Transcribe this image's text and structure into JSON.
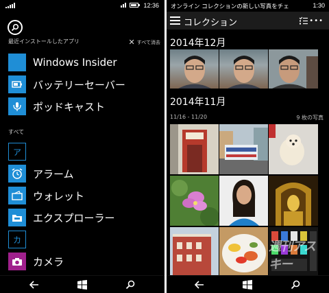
{
  "left_phone": {
    "status_time": "12:36",
    "recent_header": "最近インストールしたアプリ",
    "clear_label": "すべて消去",
    "recent_apps": [
      {
        "label": "Windows Insider",
        "icon": "windows-insider-icon"
      },
      {
        "label": "バッテリーセーバー",
        "icon": "battery-saver-icon"
      },
      {
        "label": "ポッドキャスト",
        "icon": "podcast-icon"
      }
    ],
    "all_header": "すべて",
    "letter_a": "ア",
    "apps_a": [
      {
        "label": "アラーム",
        "icon": "alarm-icon"
      },
      {
        "label": "ウォレット",
        "icon": "wallet-icon"
      },
      {
        "label": "エクスプローラー",
        "icon": "explorer-icon"
      }
    ],
    "letter_ka": "カ",
    "apps_ka": [
      {
        "label": "カメラ",
        "icon": "camera-icon"
      }
    ],
    "colors": {
      "accent": "#1f8ed6",
      "camera": "#a0208c",
      "background": "#000000"
    }
  },
  "right_phone": {
    "status_text": "オンライン コレクションの新しい写真をチェ",
    "status_time": "1:30",
    "header_title": "コレクション",
    "section_dec": "2014年12月",
    "section_nov": "2014年11月",
    "date_range": "11/16 - 11/20",
    "photo_count": "9 枚の写真",
    "watermark": "週刊アスキー"
  }
}
